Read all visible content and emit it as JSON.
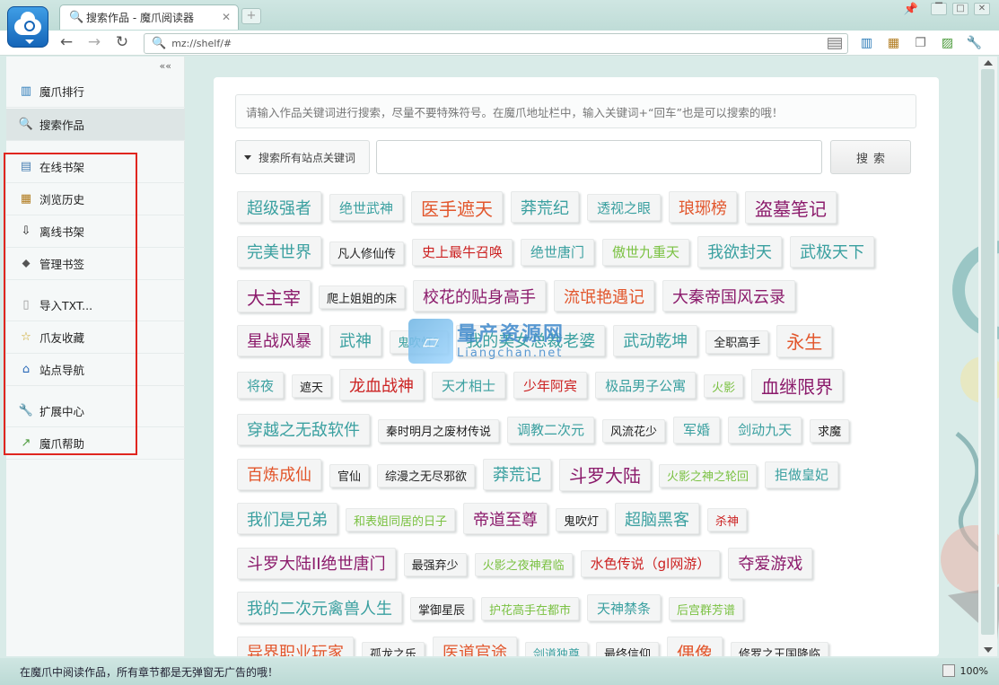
{
  "browser": {
    "tab_title": "搜索作品 - 魔爪阅读器",
    "new_tab": "+",
    "address": "mz://shelf/#",
    "window_controls": [
      "▔",
      "□",
      "✕"
    ]
  },
  "sidebar": {
    "collapse": "««",
    "items": [
      {
        "label": "魔爪排行",
        "icon": "bar-chart-icon",
        "glyph": "▥"
      },
      {
        "label": "搜索作品",
        "icon": "search-icon",
        "glyph": "🔍"
      },
      {
        "label": "在线书架",
        "icon": "book-icon",
        "glyph": "▤"
      },
      {
        "label": "浏览历史",
        "icon": "history-icon",
        "glyph": "▦"
      },
      {
        "label": "离线书架",
        "icon": "download-icon",
        "glyph": "⇩"
      },
      {
        "label": "管理书签",
        "icon": "tag-icon",
        "glyph": "⬥"
      },
      {
        "label": "导入TXT...",
        "icon": "document-icon",
        "glyph": "▯"
      },
      {
        "label": "爪友收藏",
        "icon": "star-icon",
        "glyph": "☆"
      },
      {
        "label": "站点导航",
        "icon": "home-icon",
        "glyph": "⌂"
      },
      {
        "label": "扩展中心",
        "icon": "wrench-icon",
        "glyph": "🔧"
      },
      {
        "label": "魔爪帮助",
        "icon": "help-icon",
        "glyph": "↗"
      }
    ]
  },
  "search": {
    "note": "请输入作品关键词进行搜索，尽量不要特殊符号。在魔爪地址栏中，输入关键词+“回车”也是可以搜索的哦！",
    "scope_label": "搜索所有站点关键词",
    "input_value": "",
    "button_label": "搜索"
  },
  "watermark": {
    "line1": "量产资源网",
    "line2": "Liangchan.net"
  },
  "tag_rows": [
    [
      {
        "t": "超级强者",
        "s": "s3",
        "c": "#3aa0a0"
      },
      {
        "t": "绝世武神",
        "s": "s2",
        "c": "#3aa0a0"
      },
      {
        "t": "医手遮天",
        "s": "s4",
        "c": "#e2562c"
      },
      {
        "t": "莽荒纪",
        "s": "s3",
        "c": "#3aa0a0"
      },
      {
        "t": "透视之眼",
        "s": "s2",
        "c": "#3aa0a0"
      },
      {
        "t": "琅琊榜",
        "s": "s3",
        "c": "#e2562c"
      },
      {
        "t": "盗墓笔记",
        "s": "s4",
        "c": "#8b1a6b"
      }
    ],
    [
      {
        "t": "完美世界",
        "s": "s3",
        "c": "#3aa0a0"
      },
      {
        "t": "凡人修仙传",
        "s": "s1",
        "c": "#222"
      },
      {
        "t": "史上最牛召唤",
        "s": "s2",
        "c": "#cc2222"
      },
      {
        "t": "绝世唐门",
        "s": "s2",
        "c": "#3aa0a0"
      },
      {
        "t": "傲世九重天",
        "s": "s2",
        "c": "#7ac142"
      },
      {
        "t": "我欲封天",
        "s": "s3",
        "c": "#3aa0a0"
      },
      {
        "t": "武极天下",
        "s": "s3",
        "c": "#3aa0a0"
      }
    ],
    [
      {
        "t": "大主宰",
        "s": "s4",
        "c": "#8b1a6b"
      },
      {
        "t": "爬上姐姐的床",
        "s": "s1",
        "c": "#222"
      },
      {
        "t": "校花的贴身高手",
        "s": "s3",
        "c": "#8b1a6b"
      },
      {
        "t": "流氓艳遇记",
        "s": "s3",
        "c": "#e2562c"
      },
      {
        "t": "大秦帝国风云录",
        "s": "s3",
        "c": "#8b1a6b"
      }
    ],
    [
      {
        "t": "星战风暴",
        "s": "s3",
        "c": "#8b1a6b"
      },
      {
        "t": "武神",
        "s": "s3",
        "c": "#3aa0a0"
      },
      {
        "t": "鬼吹灯2",
        "s": "s1",
        "c": "#3aa0a0"
      },
      {
        "t": "我的美女总裁老婆",
        "s": "s3",
        "c": "#3aa0a0"
      },
      {
        "t": "武动乾坤",
        "s": "s3",
        "c": "#3aa0a0"
      },
      {
        "t": "全职高手",
        "s": "s1",
        "c": "#222"
      },
      {
        "t": "永生",
        "s": "s4",
        "c": "#e2562c"
      }
    ],
    [
      {
        "t": "将夜",
        "s": "s2",
        "c": "#3aa0a0"
      },
      {
        "t": "遮天",
        "s": "s1",
        "c": "#222"
      },
      {
        "t": "龙血战神",
        "s": "s3",
        "c": "#cc2222"
      },
      {
        "t": "天才相士",
        "s": "s2",
        "c": "#3aa0a0"
      },
      {
        "t": "少年阿宾",
        "s": "s2",
        "c": "#cc2222"
      },
      {
        "t": "极品男子公寓",
        "s": "s2",
        "c": "#3aa0a0"
      },
      {
        "t": "火影",
        "s": "s1",
        "c": "#7ac142"
      },
      {
        "t": "血继限界",
        "s": "s4",
        "c": "#8b1a6b"
      }
    ],
    [
      {
        "t": "穿越之无敌软件",
        "s": "s3",
        "c": "#3aa0a0"
      },
      {
        "t": "秦时明月之废材传说",
        "s": "s1",
        "c": "#222"
      },
      {
        "t": "调教二次元",
        "s": "s2",
        "c": "#3aa0a0"
      },
      {
        "t": "风流花少",
        "s": "s1",
        "c": "#222"
      },
      {
        "t": "军婚",
        "s": "s2",
        "c": "#3aa0a0"
      },
      {
        "t": "剑动九天",
        "s": "s2",
        "c": "#3aa0a0"
      },
      {
        "t": "求魔",
        "s": "s1",
        "c": "#222"
      }
    ],
    [
      {
        "t": "百炼成仙",
        "s": "s3",
        "c": "#e2562c"
      },
      {
        "t": "官仙",
        "s": "s1",
        "c": "#222"
      },
      {
        "t": "综漫之无尽邪欲",
        "s": "s1",
        "c": "#222"
      },
      {
        "t": "莽荒记",
        "s": "s3",
        "c": "#3aa0a0"
      },
      {
        "t": "斗罗大陆",
        "s": "s4",
        "c": "#8b1a6b"
      },
      {
        "t": "火影之神之轮回",
        "s": "s1",
        "c": "#7ac142"
      },
      {
        "t": "拒做皇妃",
        "s": "s2",
        "c": "#3aa0a0"
      }
    ],
    [
      {
        "t": "我们是兄弟",
        "s": "s3",
        "c": "#3aa0a0"
      },
      {
        "t": "和表姐同居的日子",
        "s": "s1",
        "c": "#7ac142"
      },
      {
        "t": "帝道至尊",
        "s": "s3",
        "c": "#8b1a6b"
      },
      {
        "t": "鬼吹灯",
        "s": "s1",
        "c": "#222"
      },
      {
        "t": "超脑黑客",
        "s": "s3",
        "c": "#3aa0a0"
      },
      {
        "t": "杀神",
        "s": "s1",
        "c": "#cc2222"
      }
    ],
    [
      {
        "t": "斗罗大陆II绝世唐门",
        "s": "s3",
        "c": "#8b1a6b"
      },
      {
        "t": "最强弃少",
        "s": "s1",
        "c": "#222"
      },
      {
        "t": "火影之夜神君临",
        "s": "s1",
        "c": "#7ac142"
      },
      {
        "t": "水色传说（gl网游）",
        "s": "s2",
        "c": "#cc2222"
      },
      {
        "t": "夺爱游戏",
        "s": "s3",
        "c": "#8b1a6b"
      }
    ],
    [
      {
        "t": "我的二次元禽兽人生",
        "s": "s3",
        "c": "#3aa0a0"
      },
      {
        "t": "掌御星辰",
        "s": "s1",
        "c": "#222"
      },
      {
        "t": "护花高手在都市",
        "s": "s1",
        "c": "#7ac142"
      },
      {
        "t": "天神禁条",
        "s": "s2",
        "c": "#3aa0a0"
      },
      {
        "t": "后宫群芳谱",
        "s": "s1",
        "c": "#7ac142"
      }
    ],
    [
      {
        "t": "异界职业玩家",
        "s": "s3",
        "c": "#e2562c"
      },
      {
        "t": "孤龙之乐",
        "s": "s1",
        "c": "#222"
      },
      {
        "t": "医道官途",
        "s": "s3",
        "c": "#e2562c"
      },
      {
        "t": "剑道独尊",
        "s": "s1",
        "c": "#3aa0a0"
      },
      {
        "t": "最终信仰",
        "s": "s1",
        "c": "#222"
      },
      {
        "t": "偶像",
        "s": "s4",
        "c": "#e2562c"
      },
      {
        "t": "修罗之王国降临",
        "s": "s1",
        "c": "#222"
      }
    ]
  ],
  "status": {
    "text": "在魔爪中阅读作品，所有章节都是无弹窗无广告的哦！",
    "zoom": "100%"
  }
}
